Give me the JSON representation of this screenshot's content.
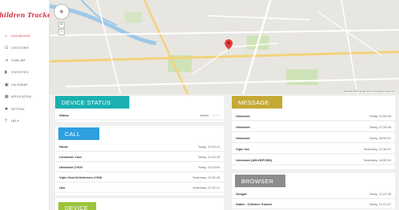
{
  "app": {
    "logo": "Children Tracker"
  },
  "sidebar": {
    "items": [
      {
        "label": "DASHBOARD",
        "icon": "home-icon",
        "glyph": "⌂"
      },
      {
        "label": "LOCATIONS",
        "icon": "map-icon",
        "glyph": "☷"
      },
      {
        "label": "TIMELINE",
        "icon": "timeline-icon",
        "glyph": "⇥"
      },
      {
        "label": "STATISTICS",
        "icon": "chart-icon",
        "glyph": "▮"
      },
      {
        "label": "CALENDAR",
        "icon": "calendar-icon",
        "glyph": "▣"
      },
      {
        "label": "APPLICATION",
        "icon": "grid-icon",
        "glyph": "▦"
      },
      {
        "label": "SETTING",
        "icon": "gear-icon",
        "glyph": "✹"
      },
      {
        "label": "HELP",
        "icon": "help-icon",
        "glyph": "?"
      }
    ]
  },
  "map": {
    "zoom_in": "+",
    "zoom_out": "−",
    "attribution": "Map data ©2015 Google   Terms of Use   Report a map error"
  },
  "device_status": {
    "title": "DEVICE STATUS",
    "label": "Status",
    "value": "Active · ········"
  },
  "call": {
    "title": "CALL",
    "rows": [
      {
        "name": "Home",
        "time": "Today, 12:28:13"
      },
      {
        "name": "Customer Care",
        "time": "Today, 12:23:29"
      },
      {
        "name": "Unknown (+919",
        "time": "Today, 12:23:50"
      },
      {
        "name": "Vipin Vora Kelvisheem (+918",
        "time": "Yesterday, 22:32:40"
      },
      {
        "name": "Unk",
        "time": "Yesterday, 21:31:21"
      }
    ]
  },
  "device": {
    "title": "DEVICE"
  },
  "message": {
    "title": "MESSAGE",
    "rows": [
      {
        "name": "Unknown",
        "time": "Today, 11:55:49"
      },
      {
        "name": "Unknown",
        "time": "Today, 07:26:48"
      },
      {
        "name": "Unknown",
        "time": "Today, 06:53:21"
      },
      {
        "name": "Vipin Vor",
        "time": "Yesterday, 21:30:07"
      },
      {
        "name": "Unknown (AM-HDFCBK)",
        "time": "Yesterday, 16:50:34"
      }
    ]
  },
  "browser": {
    "title": "BROWSER",
    "rows": [
      {
        "name": "Google",
        "time": "Today, 12:21:30"
      },
      {
        "name": "Safari - Children Tracker",
        "time": "Today, 12:21:27"
      }
    ]
  },
  "colors": {
    "accent_teal": "#1ab0b0",
    "accent_call": "#2f9fe0",
    "accent_gold": "#c6a935",
    "accent_gray": "#8c8c8c",
    "device_green": "#9bc43a",
    "brand_red": "#d9344a"
  }
}
